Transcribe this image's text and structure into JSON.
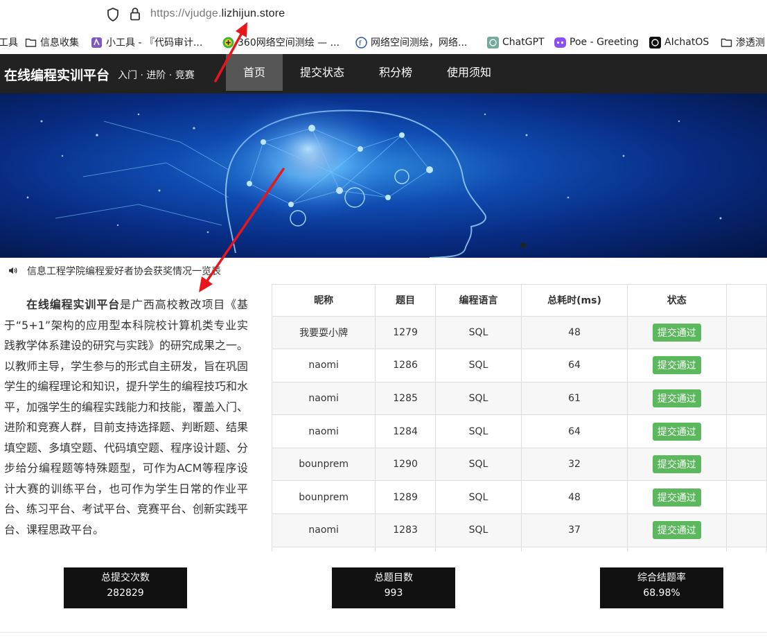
{
  "browser": {
    "url_prefix": "https://vjudge.",
    "url_domain": "lizhijun.store",
    "bookmarks": [
      {
        "label": "工具",
        "icon": "none"
      },
      {
        "label": "信息收集",
        "icon": "folder-icon"
      },
      {
        "label": "小工具 - 『代码审计...",
        "icon": "app-icon"
      },
      {
        "label": "360网络空间测绘 — ...",
        "icon": "plus-badge-icon"
      },
      {
        "label": "网络空间测绘，网络...",
        "icon": "fofa-icon"
      },
      {
        "label": "ChatGPT",
        "icon": "chatgpt-icon"
      },
      {
        "label": "Poe - Greeting",
        "icon": "poe-icon"
      },
      {
        "label": "AIchatOS",
        "icon": "chatgpt-icon"
      },
      {
        "label": "渗透测",
        "icon": "folder-icon"
      }
    ]
  },
  "nav": {
    "brand": "在线编程实训平台",
    "subtitle": "入门 · 进阶 · 竞赛",
    "items": [
      "首页",
      "提交状态",
      "积分榜",
      "使用须知"
    ],
    "active_index": 0
  },
  "notice": {
    "icon": "speaker-icon",
    "text": "信息工程学院编程爱好者协会获奖情况一览表"
  },
  "intro": {
    "bold": "在线编程实训平台",
    "rest": "是广西高校教改项目《基于“5+1”架构的应用型本科院校计算机类专业实践教学体系建设的研究与实践》的研究成果之一。以教师主导，学生参与的形式自主研发，旨在巩固学生的编程理论和知识，提升学生的编程技巧和水平，加强学生的编程实践能力和技能，覆盖入门、进阶和竞赛人群，目前支持选择题、判断题、结果填空题、多填空题、代码填空题、程序设计题、分步给分编程题等特殊题型，可作为ACM等程序设计大赛的训练平台，也可作为学生日常的作业平台、练习平台、考试平台、竞赛平台、创新实践平台、课程思政平台。"
  },
  "table": {
    "headers": [
      "昵称",
      "题目",
      "编程语言",
      "总耗时(ms)",
      "状态"
    ],
    "rows": [
      [
        "我要耍小牌",
        "1279",
        "SQL",
        "48",
        "提交通过"
      ],
      [
        "naomi",
        "1286",
        "SQL",
        "64",
        "提交通过"
      ],
      [
        "naomi",
        "1285",
        "SQL",
        "61",
        "提交通过"
      ],
      [
        "naomi",
        "1284",
        "SQL",
        "64",
        "提交通过"
      ],
      [
        "bounprem",
        "1290",
        "SQL",
        "32",
        "提交通过"
      ],
      [
        "bounprem",
        "1289",
        "SQL",
        "48",
        "提交通过"
      ],
      [
        "naomi",
        "1283",
        "SQL",
        "37",
        "提交通过"
      ],
      [
        "",
        "",
        "",
        "",
        ""
      ]
    ],
    "status_color": "#5cb85c"
  },
  "stats": [
    {
      "label": "总提交次数",
      "value": "282829"
    },
    {
      "label": "总题目数",
      "value": "993"
    },
    {
      "label": "综合结题率",
      "value": "68.98%"
    }
  ],
  "colors": {
    "nav_bg": "#222222",
    "nav_active": "#555555",
    "annotation_arrow": "#e8161b",
    "stat_bg": "#111111"
  }
}
